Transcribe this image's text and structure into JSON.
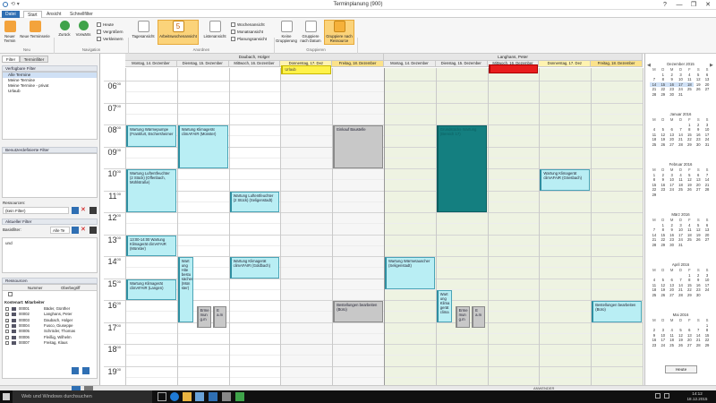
{
  "window": {
    "title": "Terminplanung (900)",
    "controls": [
      "?",
      "—",
      "❐",
      "✕"
    ]
  },
  "tabs": [
    {
      "label": "Datei"
    },
    {
      "label": "Start"
    },
    {
      "label": "Ansicht"
    },
    {
      "label": "Schnellfilter"
    }
  ],
  "ribbon": {
    "buttons": {
      "neuer_termin": "Neuer Termin",
      "neue_terminserie": "Neue Terminserie",
      "zurueck": "Zurück",
      "vorwaerts": "Vorwärts",
      "heute": "Heute",
      "vergroessern": "Vergrößern",
      "verkleinern": "Verkleinern",
      "tagesansicht": "Tagesansicht",
      "arbeitswochenansicht": "Arbeitswochenansicht",
      "listenansicht": "Listenansicht",
      "wochenansicht": "Wochenansicht",
      "monatsansicht": "Monatsansicht",
      "planungsansicht": "Planungsansicht",
      "keine_gruppierung": "Keine Gruppierung",
      "gruppiere_datum": "Gruppiere nach Datum",
      "gruppiere_ressource": "Gruppiere nach Ressource"
    },
    "groups": {
      "neu": "Neu",
      "navigation": "Navigation",
      "anordnen": "Anordnen",
      "gruppieren": "Gruppieren"
    },
    "day_icon_number": "5"
  },
  "left": {
    "tabs": [
      "Filter",
      "Terminfilter"
    ],
    "verfuegbare_filter": "Verfügbare Filter",
    "filters": [
      "Alle Termine",
      "Meine Termine",
      "Meine Termine - privat",
      "Urlaub"
    ],
    "benutzerdef": "Benutzerdefinierte Filter",
    "ressourcen_label": "Ressourcen:",
    "ressourcen_value": "(kein Filter)",
    "aktueller_filter": "Aktueller Filter",
    "basisfilter_label": "Basisfilter:",
    "basisfilter_value": "Alle Te",
    "und": "und",
    "ressourcen_header": "Ressourcen",
    "res_cols": [
      "Nummer",
      "Oberbegriff"
    ],
    "res_group": "Kostenart: Mitarbeiter",
    "resources": [
      {
        "num": "00001",
        "name": "Bäder, Günther",
        "checked": false
      },
      {
        "num": "00002",
        "name": "Langhans, Peter",
        "checked": true
      },
      {
        "num": "00003",
        "name": "Daubach, Holger",
        "checked": true
      },
      {
        "num": "00004",
        "name": "Fusco, Giuseppe",
        "checked": false
      },
      {
        "num": "00005",
        "name": "Schröder, Thomas",
        "checked": false
      },
      {
        "num": "00006",
        "name": "Fleißig, Wilhelm",
        "checked": false
      },
      {
        "num": "00007",
        "name": "Freitag, Klaus",
        "checked": false
      }
    ]
  },
  "calendar": {
    "groups": [
      "Daubach, Holger",
      "Langhans, Peter"
    ],
    "days_a": [
      "Montag, 14. Dezember",
      "Dienstag, 15. Dezember",
      "Mittwoch, 16. Dezember",
      "Donnerstag, 17. Dez",
      "Freitag, 18. Dezember"
    ],
    "days_b": [
      "Montag, 14. Dezember",
      "Dienstag, 15. Dezember",
      "Mittwoch, 16. Dezember",
      "Donnerstag, 17. Dez",
      "Freitag, 18. Dezember"
    ],
    "hours": [
      "06",
      "07",
      "08",
      "09",
      "10",
      "11",
      "12",
      "13",
      "14",
      "15",
      "16",
      "17",
      "18",
      "19"
    ],
    "minute_label": "00",
    "events": {
      "urlaub": "Urlaub",
      "e1": "Wartung Wärmepumpe (Frankfurt, Eschersheimer",
      "e2": "Wartung Klimagerät climAFAIR (Münster)",
      "e3": "Einkauf Baustelle",
      "e4": "Wartung Luftentfeuchter (2 Stück) (Offenbach, Mühlstraße)",
      "e5": "Wartung Luftentfeuchter (2 Stück) (Seligenstadt)",
      "e6": "13:00-14:00 Wartung Klimagerät climAFAIR (Münster)",
      "e7": "Wartung Klimagerät climAFAIR (Langen)",
      "e8": "Wart ung Hite bestu sächer (Mün ster)",
      "e9": "Wartung Klimagerät climAFAIR (Goldbach)",
      "e10": "Bestellungen bearbeiten (Büro)",
      "e11": "Erme mun g.m",
      "e12": "E a.m",
      "e13": "Wartung Wärmetauscher (Seligenstadt)",
      "e14": "Wart ung Klima gerät clima",
      "e15": "Erme mun g.m",
      "e16": "E a.m",
      "e17": "Wartung Klimagerät climAFAIR (Griesbach)",
      "e18": "Bestellungen bearbeiten (Büro)",
      "e_teal": "Grundstücks-Wartung (Bereich 17)"
    }
  },
  "minical": {
    "head": "Dezember",
    "head_year": "2015",
    "weekdays": [
      "M",
      "D",
      "M",
      "D",
      "F",
      "S",
      "S"
    ],
    "months": [
      {
        "name": "Dezember",
        "year": "2015",
        "rows": [
          [
            "",
            "1",
            "2",
            "3",
            "4",
            "5",
            "6"
          ],
          [
            "7",
            "8",
            "9",
            "10",
            "11",
            "12",
            "13"
          ],
          [
            "14",
            "15",
            "16",
            "17",
            "18",
            "19",
            "20"
          ],
          [
            "21",
            "22",
            "23",
            "24",
            "25",
            "26",
            "27"
          ],
          [
            "28",
            "29",
            "30",
            "31",
            "",
            "",
            ""
          ]
        ]
      },
      {
        "name": "Januar",
        "year": "2016",
        "rows": [
          [
            "",
            "",
            "",
            "",
            "1",
            "2",
            "3"
          ],
          [
            "4",
            "5",
            "6",
            "7",
            "8",
            "9",
            "10"
          ],
          [
            "11",
            "12",
            "13",
            "14",
            "15",
            "16",
            "17"
          ],
          [
            "18",
            "19",
            "20",
            "21",
            "22",
            "23",
            "24"
          ],
          [
            "25",
            "26",
            "27",
            "28",
            "29",
            "30",
            "31"
          ]
        ]
      },
      {
        "name": "Februar",
        "year": "2016",
        "rows": [
          [
            "1",
            "2",
            "3",
            "4",
            "5",
            "6",
            "7"
          ],
          [
            "8",
            "9",
            "10",
            "11",
            "12",
            "13",
            "14"
          ],
          [
            "15",
            "16",
            "17",
            "18",
            "19",
            "20",
            "21"
          ],
          [
            "22",
            "23",
            "24",
            "25",
            "26",
            "27",
            "28"
          ],
          [
            "29",
            "",
            "",
            "",
            "",
            "",
            ""
          ]
        ]
      },
      {
        "name": "März",
        "year": "2016",
        "rows": [
          [
            "",
            "1",
            "2",
            "3",
            "4",
            "5",
            "6"
          ],
          [
            "7",
            "8",
            "9",
            "10",
            "11",
            "12",
            "13"
          ],
          [
            "14",
            "15",
            "16",
            "17",
            "18",
            "19",
            "20"
          ],
          [
            "21",
            "22",
            "23",
            "24",
            "25",
            "26",
            "27"
          ],
          [
            "28",
            "29",
            "30",
            "31",
            "",
            "",
            ""
          ]
        ]
      },
      {
        "name": "April",
        "year": "2016",
        "rows": [
          [
            "",
            "",
            "",
            "",
            "1",
            "2",
            "3"
          ],
          [
            "4",
            "5",
            "6",
            "7",
            "8",
            "9",
            "10"
          ],
          [
            "11",
            "12",
            "13",
            "14",
            "15",
            "16",
            "17"
          ],
          [
            "18",
            "19",
            "20",
            "21",
            "22",
            "23",
            "24"
          ],
          [
            "25",
            "26",
            "27",
            "28",
            "29",
            "30",
            ""
          ]
        ]
      },
      {
        "name": "Mai",
        "year": "2016",
        "rows": [
          [
            "",
            "",
            "",
            "",
            "",
            "",
            "1"
          ],
          [
            "2",
            "3",
            "4",
            "5",
            "6",
            "7",
            "8"
          ],
          [
            "9",
            "10",
            "11",
            "12",
            "13",
            "14",
            "15"
          ],
          [
            "16",
            "17",
            "18",
            "19",
            "20",
            "21",
            "22"
          ],
          [
            "23",
            "24",
            "25",
            "26",
            "27",
            "28",
            "29"
          ]
        ]
      }
    ],
    "heute_button": "Heute"
  },
  "status": {
    "user": "ANWENDER"
  },
  "taskbar": {
    "search": "Web und Windows durchsuchen",
    "time": "14:12",
    "date": "18.12.2015"
  },
  "colors": {
    "event": "#b9eef4",
    "teal": "#147f80",
    "yellow": "#fff24a",
    "red": "#e81d1d",
    "grey": "#c8c8c8"
  }
}
